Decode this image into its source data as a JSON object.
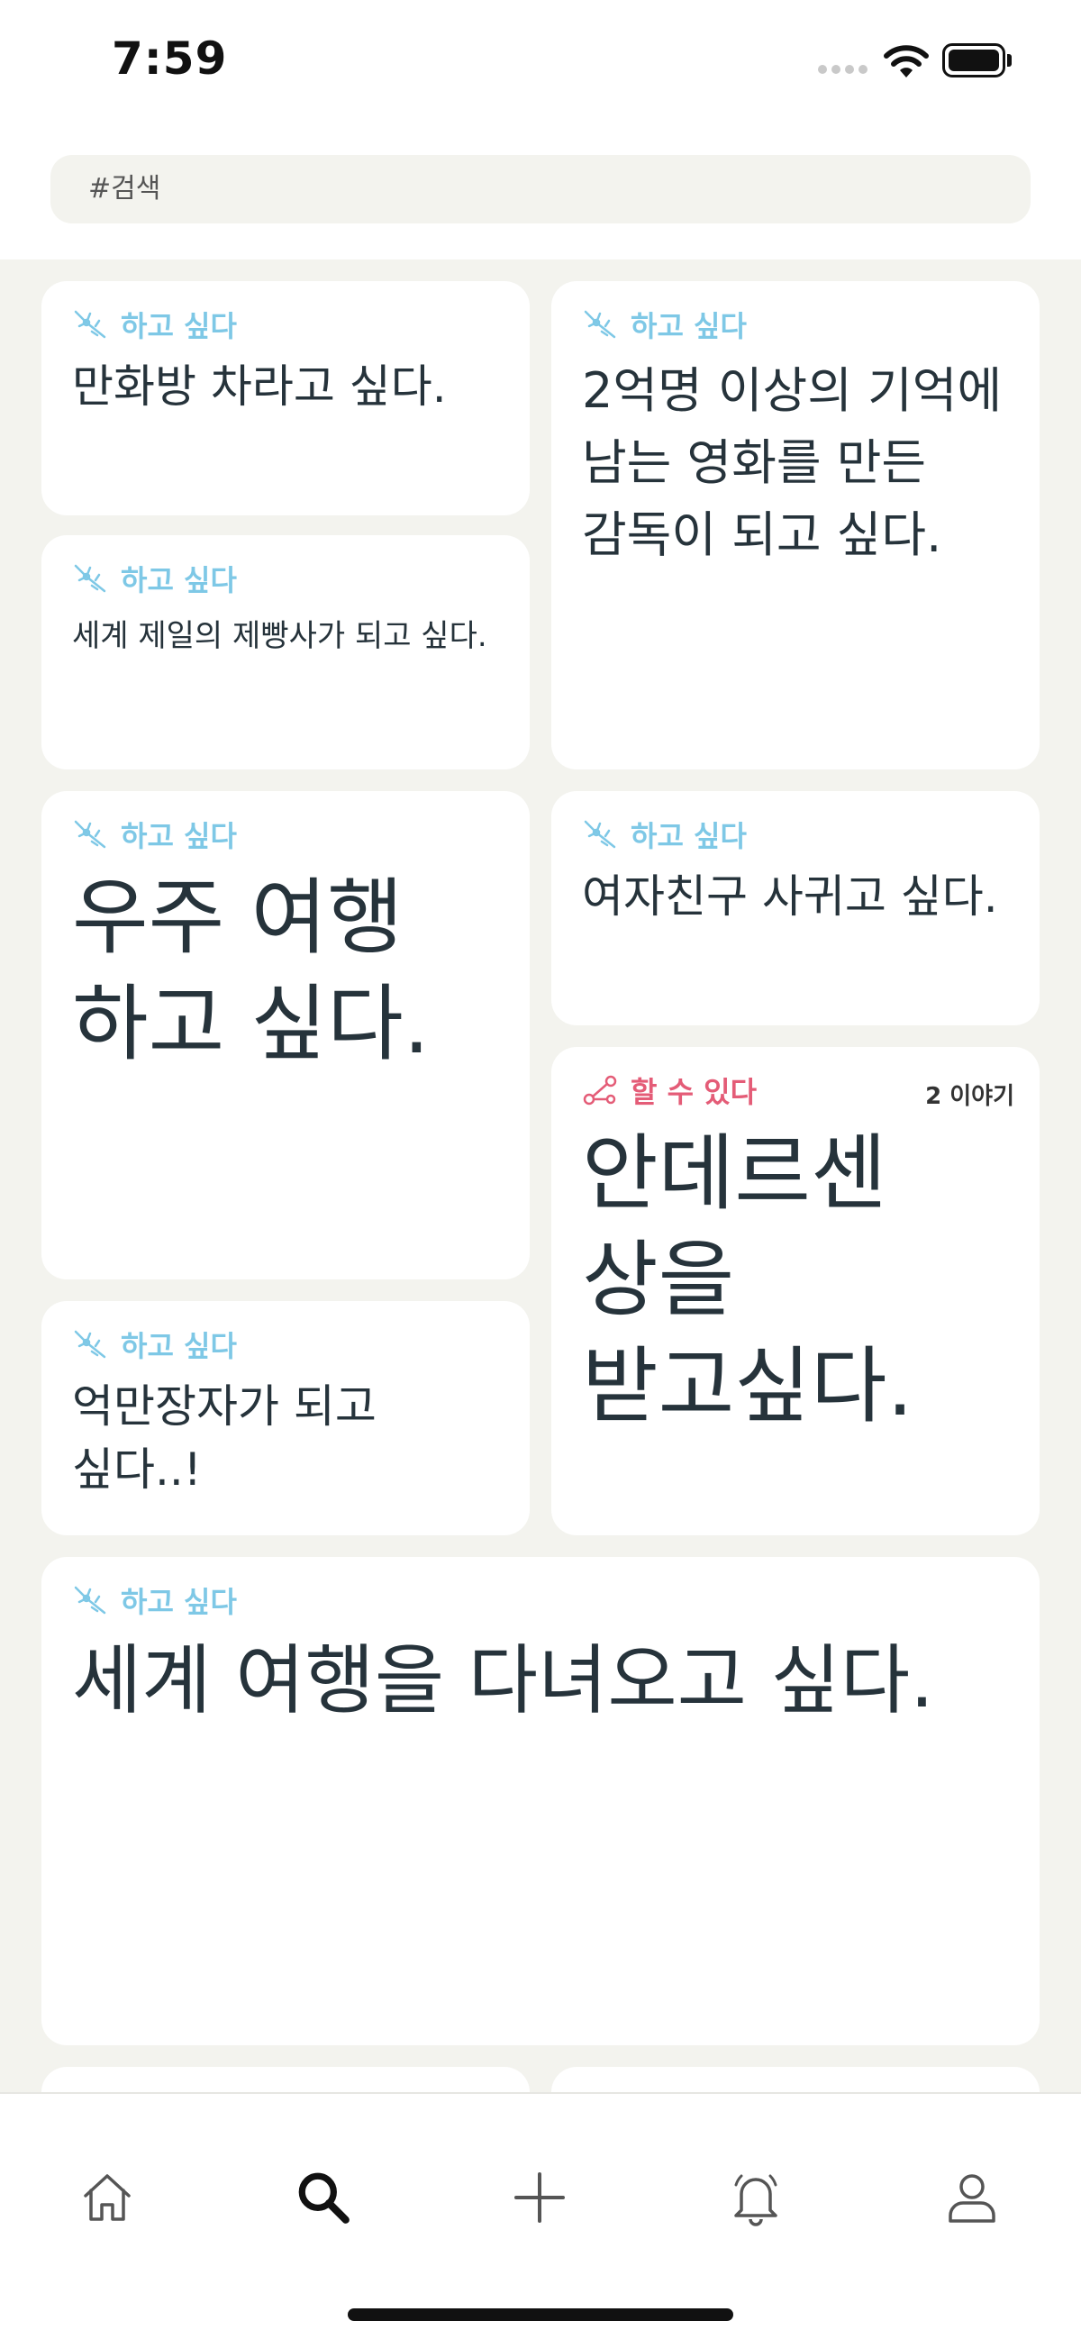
{
  "status_bar": {
    "time": "7:59"
  },
  "search": {
    "placeholder": "#검색"
  },
  "colors": {
    "want_tag": "#7ec8e6",
    "can_tag": "#e45c77",
    "feed_bg": "#f3f3ee",
    "text": "#26333b"
  },
  "cards": [
    {
      "tag_label": "하고 싶다",
      "tag_type": "want",
      "text": "만화방 차라고 싶다."
    },
    {
      "tag_label": "하고 싶다",
      "tag_type": "want",
      "text": "2억명 이상의 기억에 남는 영화를 만든 감독이 되고 싶다."
    },
    {
      "tag_label": "하고 싶다",
      "tag_type": "want",
      "text": "세계 제일의 제빵사가 되고 싶다."
    },
    {
      "tag_label": "하고 싶다",
      "tag_type": "want",
      "text": "우주 여행 하고 싶다."
    },
    {
      "tag_label": "하고 싶다",
      "tag_type": "want",
      "text": "여자친구 사귀고 싶다."
    },
    {
      "tag_label": "할 수 있다",
      "tag_type": "can",
      "story_count": "2 이야기",
      "text": "안데르센 상을 받고싶다."
    },
    {
      "tag_label": "하고 싶다",
      "tag_type": "want",
      "text": "억만장자가 되고 싶다..!"
    },
    {
      "tag_label": "하고 싶다",
      "tag_type": "want",
      "text": "세계 여행을 다녀오고 싶다."
    }
  ],
  "tab_bar": {
    "items": [
      {
        "icon": "home-icon",
        "active": false
      },
      {
        "icon": "search-icon",
        "active": true
      },
      {
        "icon": "plus-icon",
        "active": false
      },
      {
        "icon": "bell-icon",
        "active": false
      },
      {
        "icon": "profile-icon",
        "active": false
      }
    ]
  }
}
